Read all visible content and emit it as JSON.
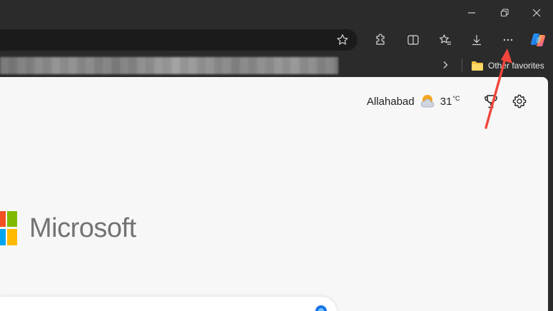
{
  "window": {
    "controls": {
      "minimize": "minimize",
      "restore": "restore",
      "close": "close"
    }
  },
  "toolbar": {
    "icons": [
      "star-icon",
      "extensions-icon",
      "split-screen-icon",
      "favorites-icon",
      "download-icon",
      "more-icon",
      "copilot-icon"
    ]
  },
  "favorites_bar": {
    "folder_label": "Other favorites"
  },
  "weather": {
    "city": "Allahabad",
    "temperature": "31",
    "unit": "°C"
  },
  "brand": {
    "name": "Microsoft",
    "colors": {
      "red": "#f25022",
      "green": "#7fba00",
      "blue": "#00a4ef",
      "yellow": "#ffb900"
    }
  },
  "annotation": {
    "arrow_color": "#f2463c"
  }
}
